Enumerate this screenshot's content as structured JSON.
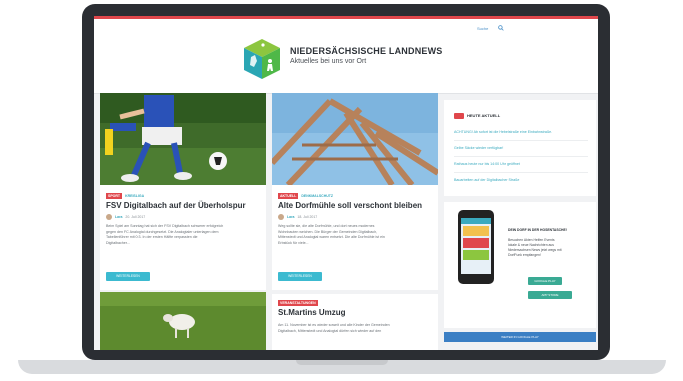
{
  "colors": {
    "accent_red": "#e0474c",
    "accent_teal": "#3aaabf",
    "button_teal": "#3cbad0",
    "dark": "#2d3238"
  },
  "header": {
    "search_label": "Suche",
    "title": "NIEDERSÄCHSISCHE LANDNEWS",
    "tagline": "Aktuelles bei uns vor Ort"
  },
  "articles": [
    {
      "badges": [
        "Sport",
        "Kreisliga"
      ],
      "title": "FSV Digitalbach auf der Überholspur",
      "author": "Lara",
      "date": "20. Juli 2017",
      "excerpt": [
        "Beim Spiel am Sonntag hat sich der FSV Digitalbach schwerer erfolgreich",
        "gegen den FC Analogtal durchgesetzt. Die Analogtaler unterlagen dem",
        "Tabellenführer mit 0:3. In der ersten Hälfte verpassten die",
        "Digitalbacher..."
      ],
      "button": "Weiterlesen"
    },
    {
      "badges": [
        "Aktuell",
        "Denkmalschutz"
      ],
      "title": "Alte Dorfmühle soll verschont bleiben",
      "author": "Lara",
      "date": "18. Juli 2017",
      "excerpt": [
        "Weg sollte sie, die alte Dorfmühle, und dort neues modernes",
        "Wohnbauten weichen. Die Bürger der Gemeinden Digitalbach,",
        "Mittenstedt und Analogtal waren entsetzt. Die alte Dorfmühle ist ein",
        "Erbstück für viele..."
      ],
      "button": "Weiterlesen"
    },
    {
      "badges": [
        "Veranstaltungen"
      ],
      "title": "St.Martins Umzug",
      "excerpt": [
        "Am 11. November ist es wieder soweit und alle Kinder der Gemeinden",
        "Digitalbach, Mittenstedt und Analogtal dürfen sich wieder auf den"
      ]
    }
  ],
  "sidebar": {
    "heute_title": "HEUTE AKTUELL",
    "news": [
      "ACHTUNG! Ab sofort ist die Hebelstraße eine Einbahnstraße.",
      "Gelbe Säcke wieder verfügbar!",
      "Rathaus heute nur bis 14:00 Uhr geöffnet",
      "Bauarbeiten auf der Digitalbacher Straße"
    ],
    "promo": {
      "title": "DEIN DORF IN DER HOSENTASCHE!",
      "text": [
        "Besuchen Akten Helfen Events",
        "lokale & neue Nachrichten aus",
        "Niedersachsen News jetzt wegs mit",
        "DorfFunk empfangen!"
      ],
      "store_1": "Google Play",
      "store_2": "App Store",
      "footer_bar": "WEITER IN GOOGLE PLAY"
    }
  }
}
